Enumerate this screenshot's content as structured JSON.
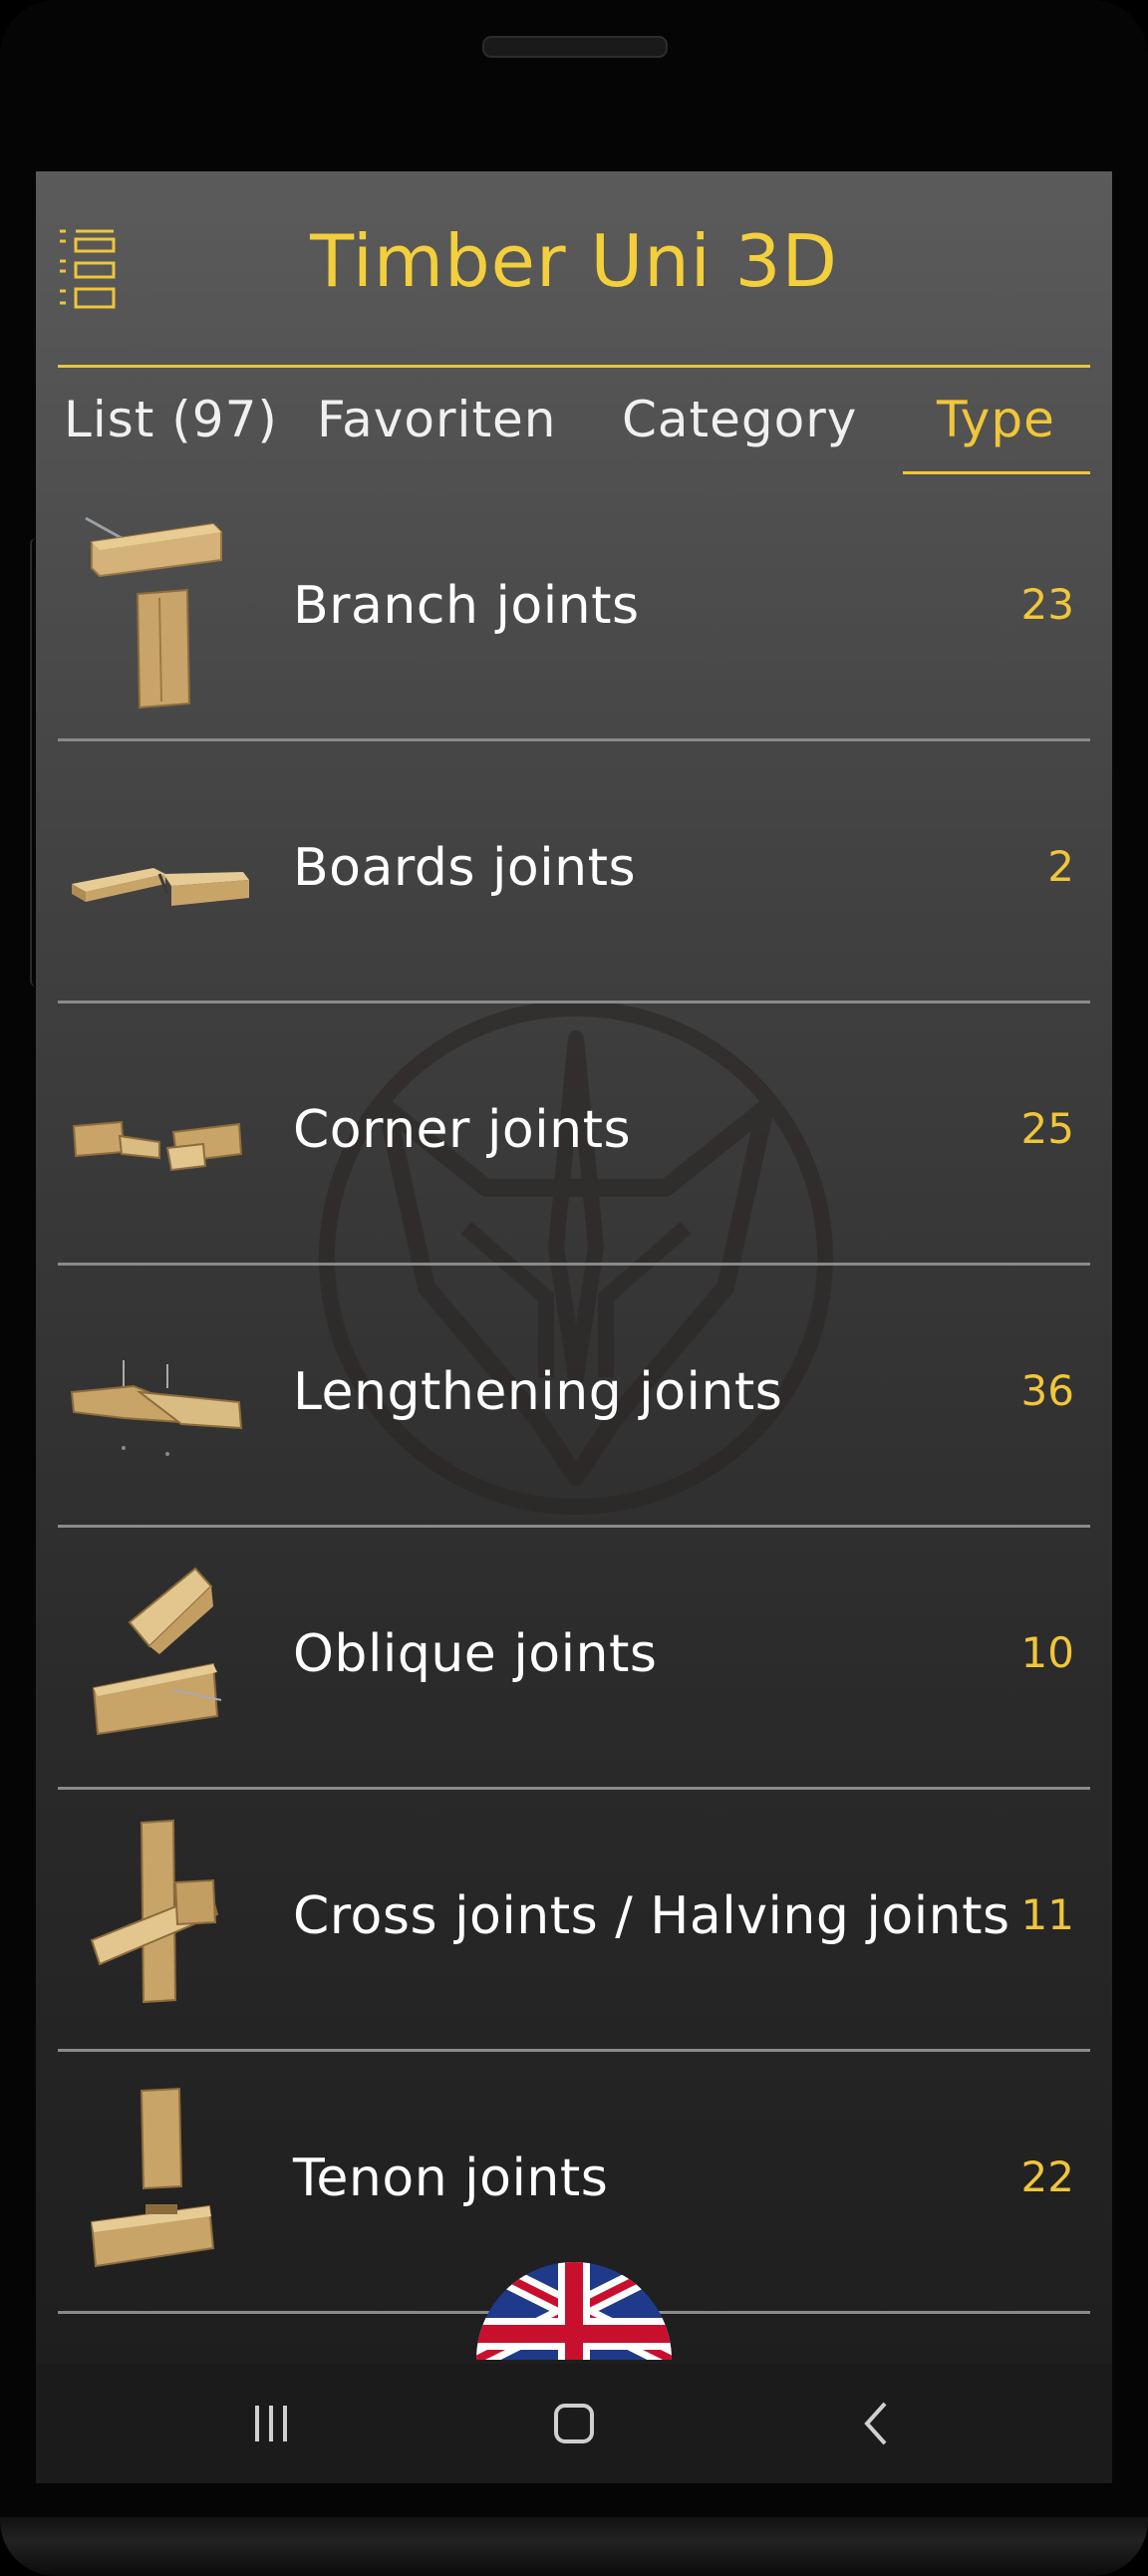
{
  "app": {
    "title": "Timber Uni 3D",
    "accent_color": "#f0c63a"
  },
  "header": {
    "menu_icon": "list-menu-icon"
  },
  "tabs": [
    {
      "label": "List (97)",
      "active": false
    },
    {
      "label": "Favoriten",
      "active": false
    },
    {
      "label": "Category",
      "active": false
    },
    {
      "label": "Type",
      "active": true
    }
  ],
  "types": [
    {
      "label": "Branch joints",
      "count": "23",
      "thumb": "branch-joint-thumbnail"
    },
    {
      "label": "Boards joints",
      "count": "2",
      "thumb": "boards-joint-thumbnail"
    },
    {
      "label": "Corner joints",
      "count": "25",
      "thumb": "corner-joint-thumbnail"
    },
    {
      "label": "Lengthening joints",
      "count": "36",
      "thumb": "lengthening-joint-thumbnail"
    },
    {
      "label": "Oblique joints",
      "count": "10",
      "thumb": "oblique-joint-thumbnail"
    },
    {
      "label": "Cross joints / Halving joints",
      "count": "11",
      "thumb": "cross-joint-thumbnail"
    },
    {
      "label": "Tenon joints",
      "count": "22",
      "thumb": "tenon-joint-thumbnail"
    }
  ],
  "language_button": {
    "icon": "union-jack-flag-icon"
  },
  "navbar": {
    "recent": "recent-apps-icon",
    "home": "home-icon",
    "back": "back-icon"
  }
}
